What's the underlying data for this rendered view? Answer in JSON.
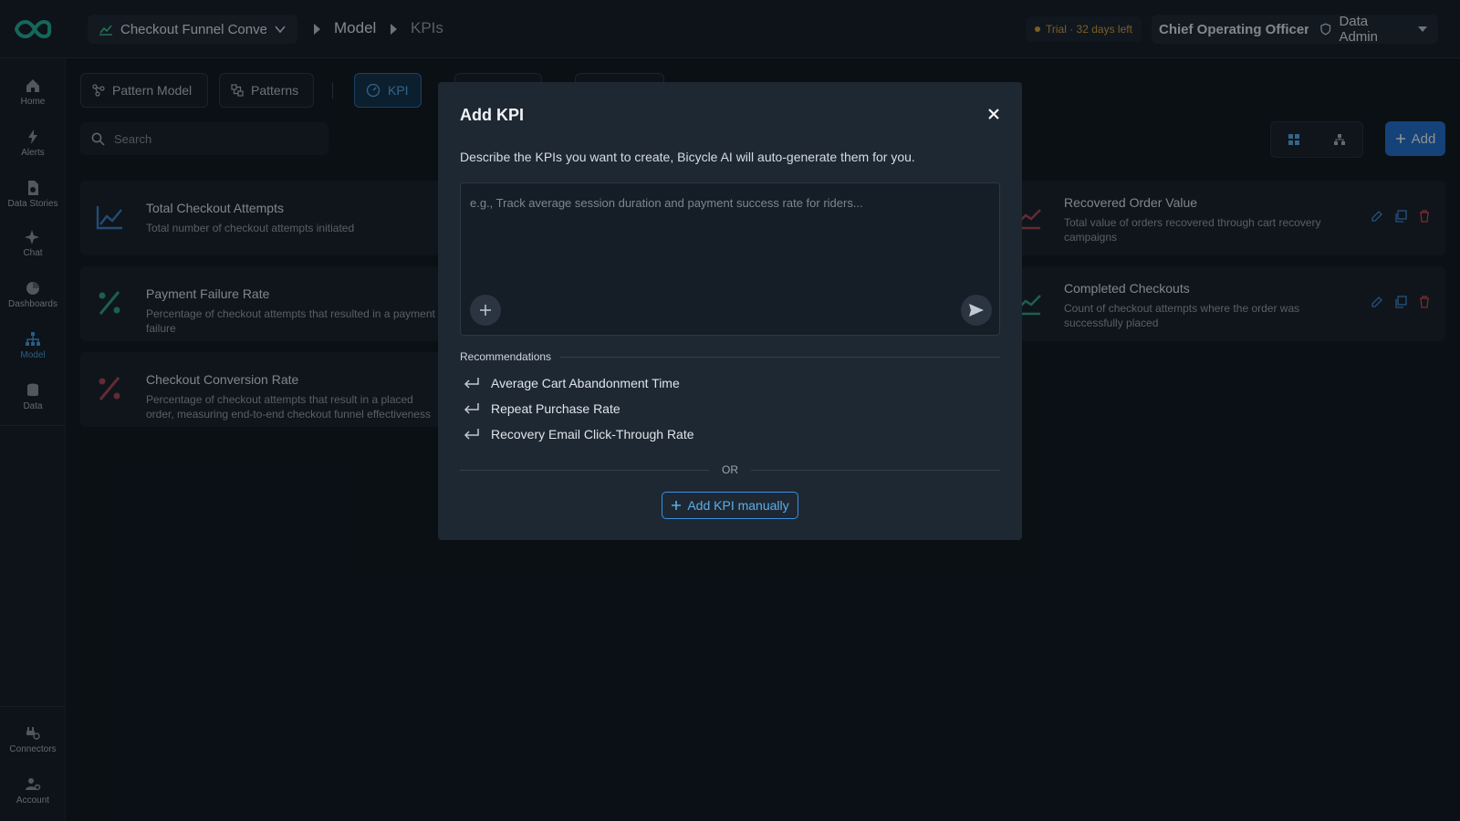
{
  "header": {
    "model_select": "Checkout Funnel Conver...",
    "breadcrumb": [
      "Model",
      "KPIs"
    ],
    "trial": "Trial · 32 days left",
    "role": "Chief Operating Officer",
    "admin": "Data Admin"
  },
  "sidebar": {
    "items": [
      {
        "label": "Home"
      },
      {
        "label": "Alerts"
      },
      {
        "label": "Data Stories"
      },
      {
        "label": "Chat"
      },
      {
        "label": "Dashboards"
      },
      {
        "label": "Model"
      },
      {
        "label": "Data"
      },
      {
        "label": "Connectors"
      },
      {
        "label": "Account"
      }
    ]
  },
  "tabs": [
    {
      "label": "Pattern Model"
    },
    {
      "label": "Patterns"
    },
    {
      "label": "KPI"
    }
  ],
  "search": {
    "placeholder": "Search"
  },
  "toolbar": {
    "add_label": "Add"
  },
  "kpis": [
    {
      "title": "Total Checkout Attempts",
      "desc": "Total number of checkout attempts initiated"
    },
    {
      "title": "Payment Failure Rate",
      "desc": "Percentage of checkout attempts that resulted in a payment failure"
    },
    {
      "title": "Checkout Conversion Rate",
      "desc": "Percentage of checkout attempts that result in a placed order, measuring end-to-end checkout funnel effectiveness"
    },
    {
      "title": "Recovered Order Value",
      "desc": "Total value of orders recovered through cart recovery campaigns"
    },
    {
      "title": "Completed Checkouts",
      "desc": "Count of checkout attempts where the order was successfully placed"
    }
  ],
  "modal": {
    "title": "Add KPI",
    "description": "Describe the KPIs you want to create, Bicycle AI will auto-generate them for you.",
    "placeholder": "e.g., Track average session duration and payment success rate for riders...",
    "recommendations_label": "Recommendations",
    "recommendations": [
      "Average Cart Abandonment Time",
      "Repeat Purchase Rate",
      "Recovery Email Click-Through Rate"
    ],
    "or_label": "OR",
    "manual_label": "Add KPI manually"
  },
  "colors": {
    "accent": "#1f6fd1",
    "trial": "#d9a23a",
    "delete": "#d84a4a"
  }
}
